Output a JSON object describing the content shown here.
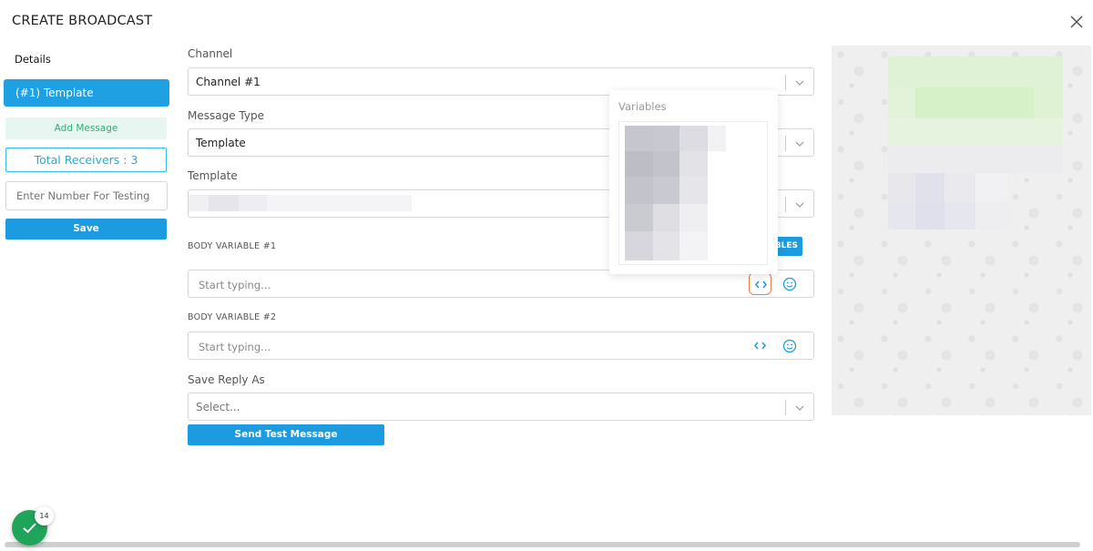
{
  "header": {
    "title": "CREATE BROADCAST",
    "close_icon": "close-icon"
  },
  "sidebar": {
    "details_label": "Details",
    "template_item": "(#1) Template",
    "add_message": "Add Message",
    "total_receivers": "Total Receivers : 3",
    "test_number_placeholder": "Enter Number For Testing",
    "save_label": "Save"
  },
  "form": {
    "channel": {
      "label": "Channel",
      "value": "Channel #1"
    },
    "message_type": {
      "label": "Message Type",
      "value": "Template"
    },
    "template": {
      "label": "Template"
    },
    "body_variable_1": {
      "label": "BODY VARIABLE #1",
      "placeholder": "Start typing..."
    },
    "body_variable_2": {
      "label": "BODY VARIABLE #2",
      "placeholder": "Start typing..."
    },
    "variables_button_partial": "BLES",
    "save_reply_as": {
      "label": "Save Reply As",
      "placeholder": "Select..."
    },
    "send_test_label": "Send Test Message"
  },
  "variables_popup": {
    "title": "Variables"
  },
  "notification": {
    "count": "14",
    "icon": "check-icon"
  },
  "colors": {
    "primary": "#1d9be0",
    "success": "#1fa55a",
    "highlight": "#f07c43"
  }
}
